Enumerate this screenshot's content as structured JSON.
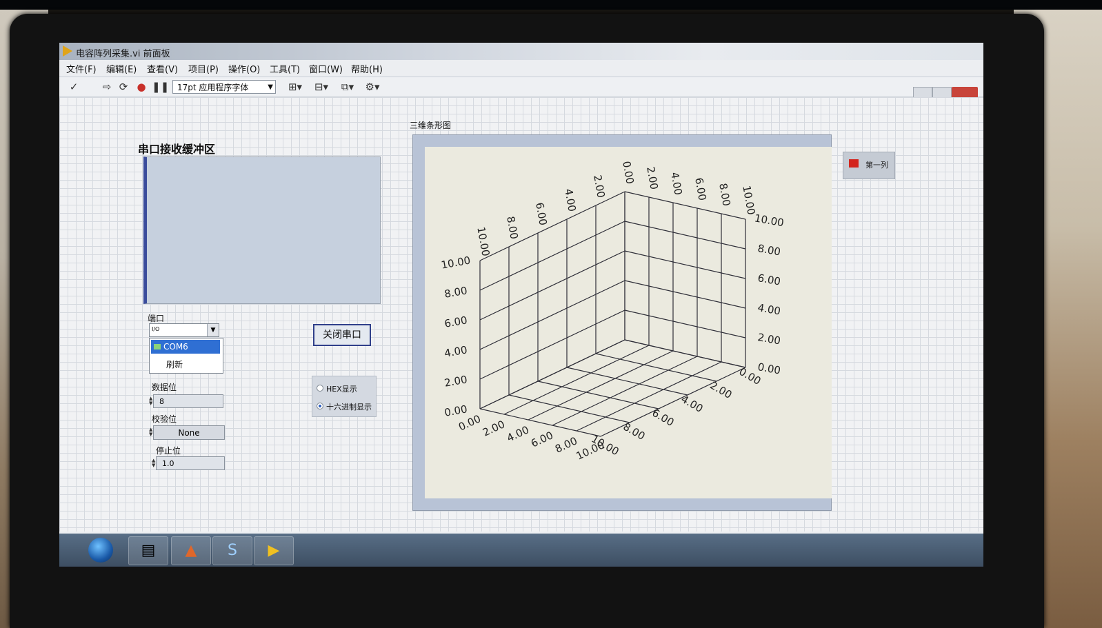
{
  "window": {
    "title": "电容阵列采集.vi 前面板"
  },
  "menu": [
    "文件(F)",
    "编辑(E)",
    "查看(V)",
    "项目(P)",
    "操作(O)",
    "工具(T)",
    "窗口(W)",
    "帮助(H)"
  ],
  "toolbar": {
    "icons": [
      "check-icon",
      "run-arrow-icon",
      "run-continuous-icon",
      "abort-icon",
      "pause-icon",
      "align-icon",
      "distribute-icon",
      "resize-icon",
      "reorder-icon",
      "search-icon",
      "help-icon"
    ],
    "font_select": "17pt 应用程序字体"
  },
  "panel": {
    "buffer_label": "串口接收缓冲区",
    "port_label": "端口",
    "port_value": "I/O",
    "port_options": [
      "COM6",
      "刷新"
    ],
    "port_selected": "COM6",
    "databits_label": "数据位",
    "databits_value": "8",
    "parity_label": "校验位",
    "parity_value": "None",
    "stopbits_label": "停止位",
    "stopbits_value": "1.0",
    "close_port_button": "关闭串口",
    "display_modes": [
      "HEX显示",
      "十六进制显示"
    ],
    "display_selected": "十六进制显示"
  },
  "graph": {
    "label": "三维条形图",
    "legend": "第一列",
    "legend_color": "#d3241d"
  },
  "chart_data": {
    "type": "bar3d",
    "title": "三维条形图",
    "x_ticks": [
      "0.00",
      "2.00",
      "4.00",
      "6.00",
      "8.00",
      "10.00"
    ],
    "y_ticks": [
      "0.00",
      "2.00",
      "4.00",
      "6.00",
      "8.00",
      "10.00"
    ],
    "z_ticks": [
      "0.00",
      "2.00",
      "4.00",
      "6.00",
      "8.00",
      "10.00"
    ],
    "xlim": [
      0,
      10
    ],
    "ylim": [
      0,
      10
    ],
    "zlim": [
      0,
      10
    ],
    "grid": true,
    "series": []
  }
}
